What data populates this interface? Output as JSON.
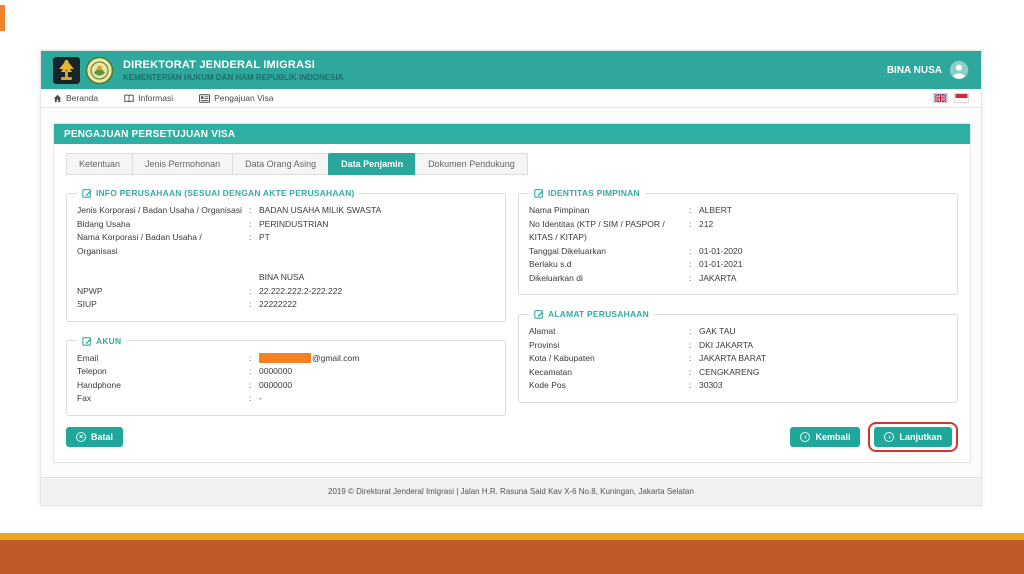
{
  "ui": {
    "colon": ":"
  },
  "colors": {
    "masthead_teal": "#2EA89D",
    "panel_teal": "#2EAFA4",
    "button_teal": "#1FA79B",
    "annotation_red": "#D3362C",
    "slide_accent_orange": "#EDA31C",
    "slide_bar_orange": "#C05B28",
    "redaction_orange": "#F5821F"
  },
  "masthead": {
    "title": "DIREKTORAT JENDERAL IMIGRASI",
    "subtitle": "KEMENTERIAN HUKUM DAN HAM REPUBLIK INDONESIA",
    "account_name": "BINA NUSA"
  },
  "nav": {
    "items": [
      {
        "icon": "home-icon",
        "label": "Beranda"
      },
      {
        "icon": "book-icon",
        "label": "Informasi"
      },
      {
        "icon": "card-icon",
        "label": "Pengajuan Visa"
      }
    ],
    "flags": [
      "uk-flag",
      "indonesia-flag"
    ]
  },
  "panel": {
    "title": "PENGAJUAN PERSETUJUAN VISA",
    "tabs": [
      {
        "label": "Ketentuan",
        "active": false
      },
      {
        "label": "Jenis Permohonan",
        "active": false
      },
      {
        "label": "Data Orang Asing",
        "active": false
      },
      {
        "label": "Data Penjamin",
        "active": true
      },
      {
        "label": "Dokumen Pendukung",
        "active": false
      }
    ],
    "sections": {
      "info_perusahaan": {
        "legend": "INFO PERUSAHAAN (SESUAI DENGAN AKTE PERUSAHAAN)",
        "fields": [
          {
            "label": "Jenis Korporasi / Badan Usaha / Organisasi",
            "value": "BADAN USAHA MILIK SWASTA"
          },
          {
            "label": "Bidang Usaha",
            "value": "PERINDUSTRIAN"
          },
          {
            "label": "Nama Korporasi / Badan Usaha / Organisasi",
            "value": "PT"
          },
          {
            "label": "",
            "value": "BINA NUSA"
          },
          {
            "label": "NPWP",
            "value": "22.222.222.2-222.222"
          },
          {
            "label": "SIUP",
            "value": "22222222"
          }
        ]
      },
      "identitas_pimpinan": {
        "legend": "IDENTITAS PIMPINAN",
        "fields": [
          {
            "label": "Nama Pimpinan",
            "value": "ALBERT"
          },
          {
            "label": "No Identitas (KTP / SIM / PASPOR / KITAS / KITAP)",
            "value": "212"
          },
          {
            "label": "Tanggal Dikeluarkan",
            "value": "01-01-2020"
          },
          {
            "label": "Berlaku s.d",
            "value": "01-01-2021"
          },
          {
            "label": "Dikeluarkan di",
            "value": "JAKARTA"
          }
        ]
      },
      "akun": {
        "legend": "AKUN",
        "email_label": "Email",
        "email_redacted": true,
        "email_suffix": "@gmail.com",
        "fields": [
          {
            "label": "Telepon",
            "value": "0000000"
          },
          {
            "label": "Handphone",
            "value": "0000000"
          },
          {
            "label": "Fax",
            "value": "-"
          }
        ]
      },
      "alamat_perusahaan": {
        "legend": "ALAMAT PERUSAHAAN",
        "fields": [
          {
            "label": "Alamat",
            "value": "GAK TAU"
          },
          {
            "label": "Provinsi",
            "value": "DKI JAKARTA"
          },
          {
            "label": "Kota / Kabupaten",
            "value": "JAKARTA BARAT"
          },
          {
            "label": "Kecamatan",
            "value": "CENGKARENG"
          },
          {
            "label": "Kode Pos",
            "value": "30303"
          }
        ]
      }
    },
    "buttons": {
      "batal": "Batal",
      "kembali": "Kembali",
      "lanjutkan": "Lanjutkan",
      "batal_glyph": "×",
      "kembali_glyph": "‹",
      "lanjutkan_glyph": "›"
    }
  },
  "frame_footer": "2019 © Direktorat Jenderal Imigrasi | Jalan H.R. Rasuna Said Kav X-6 No.8, Kuningan, Jakarta Selatan"
}
